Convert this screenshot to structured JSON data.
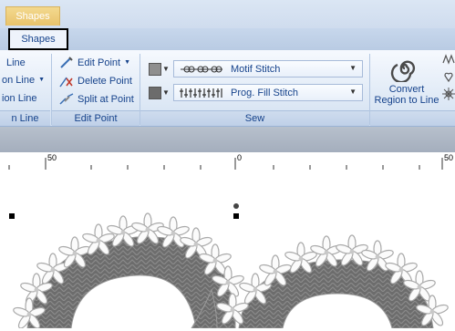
{
  "window": {
    "context_tab": "Shapes"
  },
  "tabs": {
    "active": "Shapes"
  },
  "groups": {
    "line": {
      "items": [
        "Line",
        "on Line",
        "ion Line"
      ],
      "label": "n Line"
    },
    "edit_point": {
      "items": [
        "Edit Point",
        "Delete Point",
        "Split at Point"
      ],
      "label": "Edit Point"
    },
    "sew": {
      "line_stitch": "Motif Stitch",
      "region_stitch": "Prog. Fill Stitch",
      "label": "Sew"
    },
    "convert": {
      "label_line1": "Convert",
      "label_line2": "Region to Line"
    }
  },
  "ruler": {
    "labels": [
      "50",
      "0",
      "50"
    ]
  },
  "colors": {
    "ribbon": "#dde8f5",
    "tab_text": "#15428b",
    "embroidery": "#6c6c6c",
    "motif": "#cfcfcf",
    "context_tab": "#ebc56e"
  }
}
